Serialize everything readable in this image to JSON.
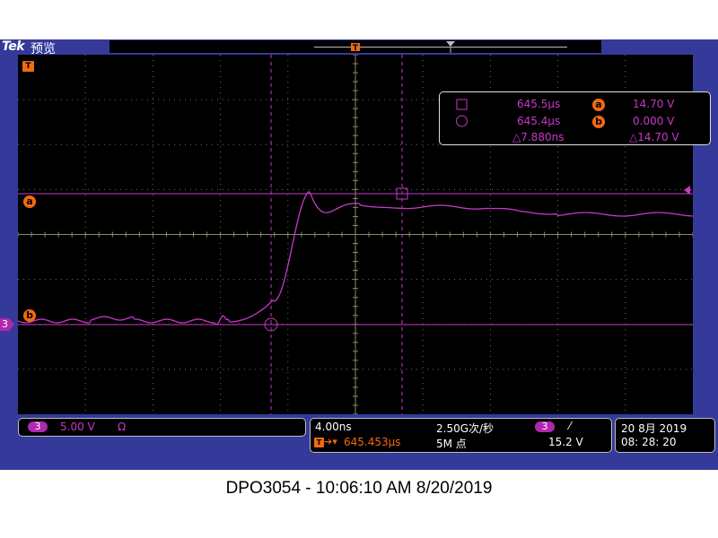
{
  "header": {
    "brand": "Tek",
    "mode": "预览"
  },
  "cursors": {
    "a_time": "645.5µs",
    "b_time": "645.4µs",
    "delta_time": "△7.880ns",
    "a_label": "a",
    "b_label": "b",
    "a_value": "14.70 V",
    "b_value": "0.000 V",
    "delta_value": "△14.70 V"
  },
  "markers": {
    "ref_a": "a",
    "ref_b": "b",
    "channel": "3",
    "trigger": "T"
  },
  "channel_box": {
    "channel": "3",
    "scale": "5.00 V",
    "coupling": "Ω"
  },
  "horizontal_box": {
    "timebase": "4.00ns",
    "sample_rate": "2.50G次/秒",
    "position": "645.453µs",
    "record_length": "5M 点",
    "trig_channel": "3",
    "trig_slope": "⁄",
    "trig_level": "15.2 V"
  },
  "datetime_box": {
    "date": "20 8月   2019",
    "time": "08: 28: 20"
  },
  "caption": "DPO3054 - 10:06:10 AM   8/20/2019",
  "colors": {
    "trace": "#c838c8",
    "cursor": "#c838c8",
    "grid": "#6e6e6e",
    "frame": "#34399a",
    "accent": "#f26a0f"
  }
}
